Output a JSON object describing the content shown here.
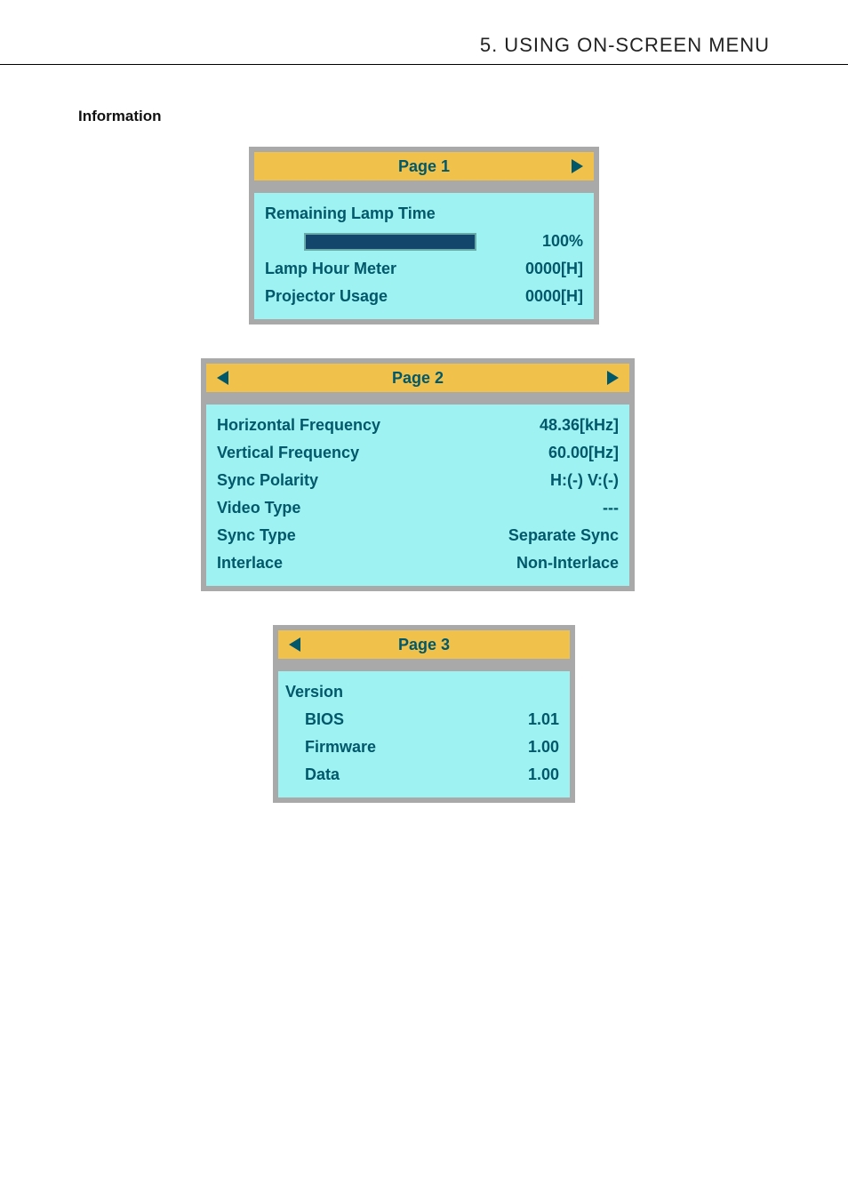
{
  "header": {
    "title": "5. USING ON-SCREEN MENU"
  },
  "section": {
    "heading": "Information"
  },
  "panel1": {
    "title": "Page 1",
    "remaining_lamp_time_label": "Remaining Lamp Time",
    "remaining_lamp_time_value": "100%",
    "lamp_hour_meter_label": "Lamp Hour Meter",
    "lamp_hour_meter_value": "0000[H]",
    "projector_usage_label": "Projector Usage",
    "projector_usage_value": "0000[H]"
  },
  "panel2": {
    "title": "Page 2",
    "hfreq_label": "Horizontal Frequency",
    "hfreq_value": "48.36[kHz]",
    "vfreq_label": "Vertical Frequency",
    "vfreq_value": "60.00[Hz]",
    "sync_polarity_label": "Sync Polarity",
    "sync_polarity_value": "H:(-) V:(-)",
    "video_type_label": "Video Type",
    "video_type_value": "---",
    "sync_type_label": "Sync Type",
    "sync_type_value": "Separate Sync",
    "interlace_label": "Interlace",
    "interlace_value": "Non-Interlace"
  },
  "panel3": {
    "title": "Page 3",
    "version_label": "Version",
    "bios_label": "BIOS",
    "bios_value": "1.01",
    "firmware_label": "Firmware",
    "firmware_value": "1.00",
    "data_label": "Data",
    "data_value": "1.00"
  }
}
